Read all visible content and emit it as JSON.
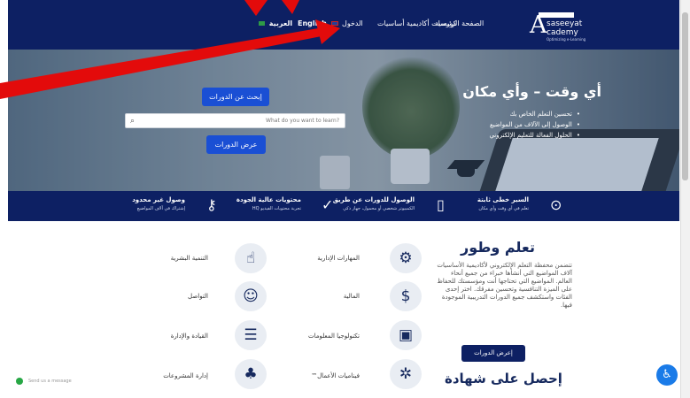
{
  "navbar": {
    "links": [
      {
        "label": "الصفحة الرئيسية"
      },
      {
        "label": "كورسات أكاديمية أساسيات"
      },
      {
        "label": "الدخول"
      },
      {
        "label": "English"
      },
      {
        "label": "العربية"
      }
    ],
    "logo": {
      "line1": "saseeyat",
      "line2": "cademy",
      "letter": "A",
      "tagline": "Optimizing e-Learning"
    }
  },
  "hero": {
    "title": "أي وقت – وأي مكان",
    "bullets": [
      "تحسين التعلم الخاص بك",
      "الوصول إلى الآلاف من المواضيع",
      "الحلول الفعالة للتعليم الإلكتروني"
    ],
    "search_courses_button": "إبحث عن الدورات",
    "search_placeholder": "What do you want to learn?",
    "show_courses_button": "عرض الدورات"
  },
  "features": [
    {
      "title": "السير خطى ثابتة",
      "subtitle": "تعلم في أي وقت وأي مكان"
    },
    {
      "title": "الوصول للدورات عن طريق",
      "subtitle": "الكمبيوتر شخصي أو محمول، جهاز ذكي"
    },
    {
      "title": "محتويات عالية الجودة",
      "subtitle": "تجربة محتويات الفيديو HQ"
    },
    {
      "title": "وصول غير محدود",
      "subtitle": "إشتراك في آلاف المواضيع"
    }
  ],
  "learn": {
    "title": "تعلم وطور",
    "text": "تتضمن محفظة التعلم الإلكتروني لأكاديمية الأساسيات آلاف المواضيع التي أنشأها خبراء من جميع أنحاء العالم. المواضيع التي تحتاجها أنت ومؤسستك للحفاظ على الميزة التنافسية وتحسين مفرقك. اختر إحدى الفئات واستكشف جميع الدورات التدريبية الموجودة فيها.",
    "button": "إعرض الدورات"
  },
  "certificate_title": "إحصل على شهادة",
  "categories": [
    {
      "label": "المهارات الإدارية",
      "icon": "gears-icon"
    },
    {
      "label": "التنمية البشرية",
      "icon": "hand-people-icon"
    },
    {
      "label": "المالية",
      "icon": "money-gear-icon"
    },
    {
      "label": "التواصل",
      "icon": "chat-bubbles-icon"
    },
    {
      "label": "تكنولوجيا المعلومات",
      "icon": "monitor-icon"
    },
    {
      "label": "القيادة والإدارة",
      "icon": "team-icon"
    },
    {
      "label": "فيناميات الأعمال™",
      "icon": "business-gear-icon"
    },
    {
      "label": "إدارة المشروعات",
      "icon": "hierarchy-icon"
    }
  ],
  "chat": {
    "label": "Send us a message"
  },
  "colors": {
    "navy": "#0d2063",
    "button_blue": "#1a4fd4",
    "annotation_red": "#e30b0b",
    "accessibility_blue": "#1a7be8"
  }
}
